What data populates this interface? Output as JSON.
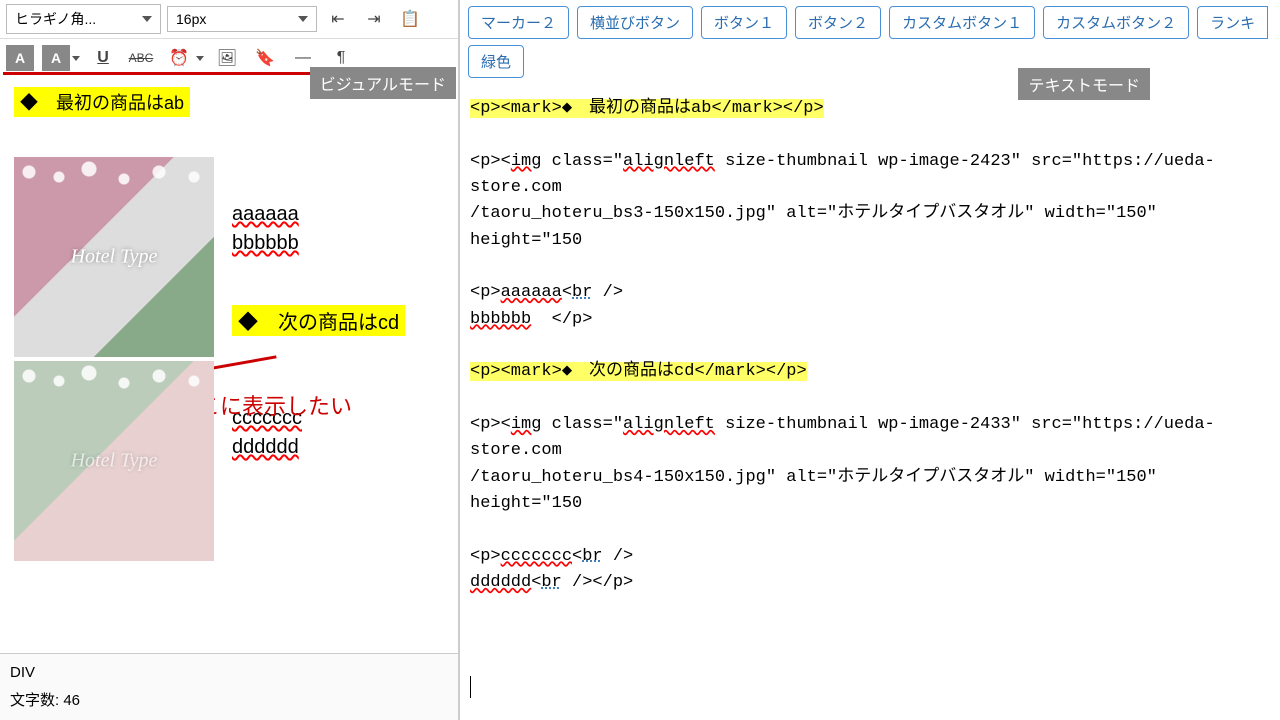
{
  "left": {
    "font_family": "ヒラギノ角...",
    "font_size": "16px",
    "mode_label": "ビジュアルモード",
    "mark1": "◆　最初の商品はab",
    "side1a": "aaaaaa",
    "side1b": "bbbbbb",
    "mark2": "◆　次の商品はcd",
    "annot": "本来はここに表示したい",
    "side2a": "ccccccc",
    "side2b": "dddddd",
    "thumb_label": "Hotel Type",
    "status_path": "DIV",
    "status_count": "文字数: 46"
  },
  "right": {
    "buttons": [
      "マーカー２",
      "横並びボタン",
      "ボタン１",
      "ボタン２",
      "カスタムボタン１",
      "カスタムボタン２",
      "ランキ"
    ],
    "buttons2": [
      "緑色"
    ],
    "mode_label": "テキストモード",
    "lines": {
      "l1a": "<p><mark>◆　最初の商品はab</mark></p>",
      "l2a": "<p><",
      "l2_img": "img",
      "l2b": " class=\"",
      "l2_al": "alignleft",
      "l2c": " size-thumbnail wp-image-2423\" src=\"https://ueda-store.com",
      "l3": "/taoru_hoteru_bs3-150x150.jpg\" alt=\"ホテルタイプバスタオル\" width=\"150\" height=\"150",
      "l4a": "<p>",
      "l4_aa": "aaaaaa",
      "l4b": "<",
      "l4_br": "br",
      "l4c": " />",
      "l5_bb": "bbbbbb",
      "l5b": "  </p>",
      "l6a": "<p><mark>◆　次の商品はcd</mark></p>",
      "l7a": "<p><",
      "l7_img": "img",
      "l7b": " class=\"",
      "l7_al": "alignleft",
      "l7c": " size-thumbnail wp-image-2433\" src=\"https://ueda-store.com",
      "l8": "/taoru_hoteru_bs4-150x150.jpg\" alt=\"ホテルタイプバスタオル\" width=\"150\" height=\"150",
      "l9a": "<p>",
      "l9_cc": "ccccccc",
      "l9b": "<",
      "l9_br": "br",
      "l9c": " />",
      "l10_dd": "dddddd",
      "l10a": "<",
      "l10_br": "br",
      "l10b": " /></p>"
    }
  }
}
